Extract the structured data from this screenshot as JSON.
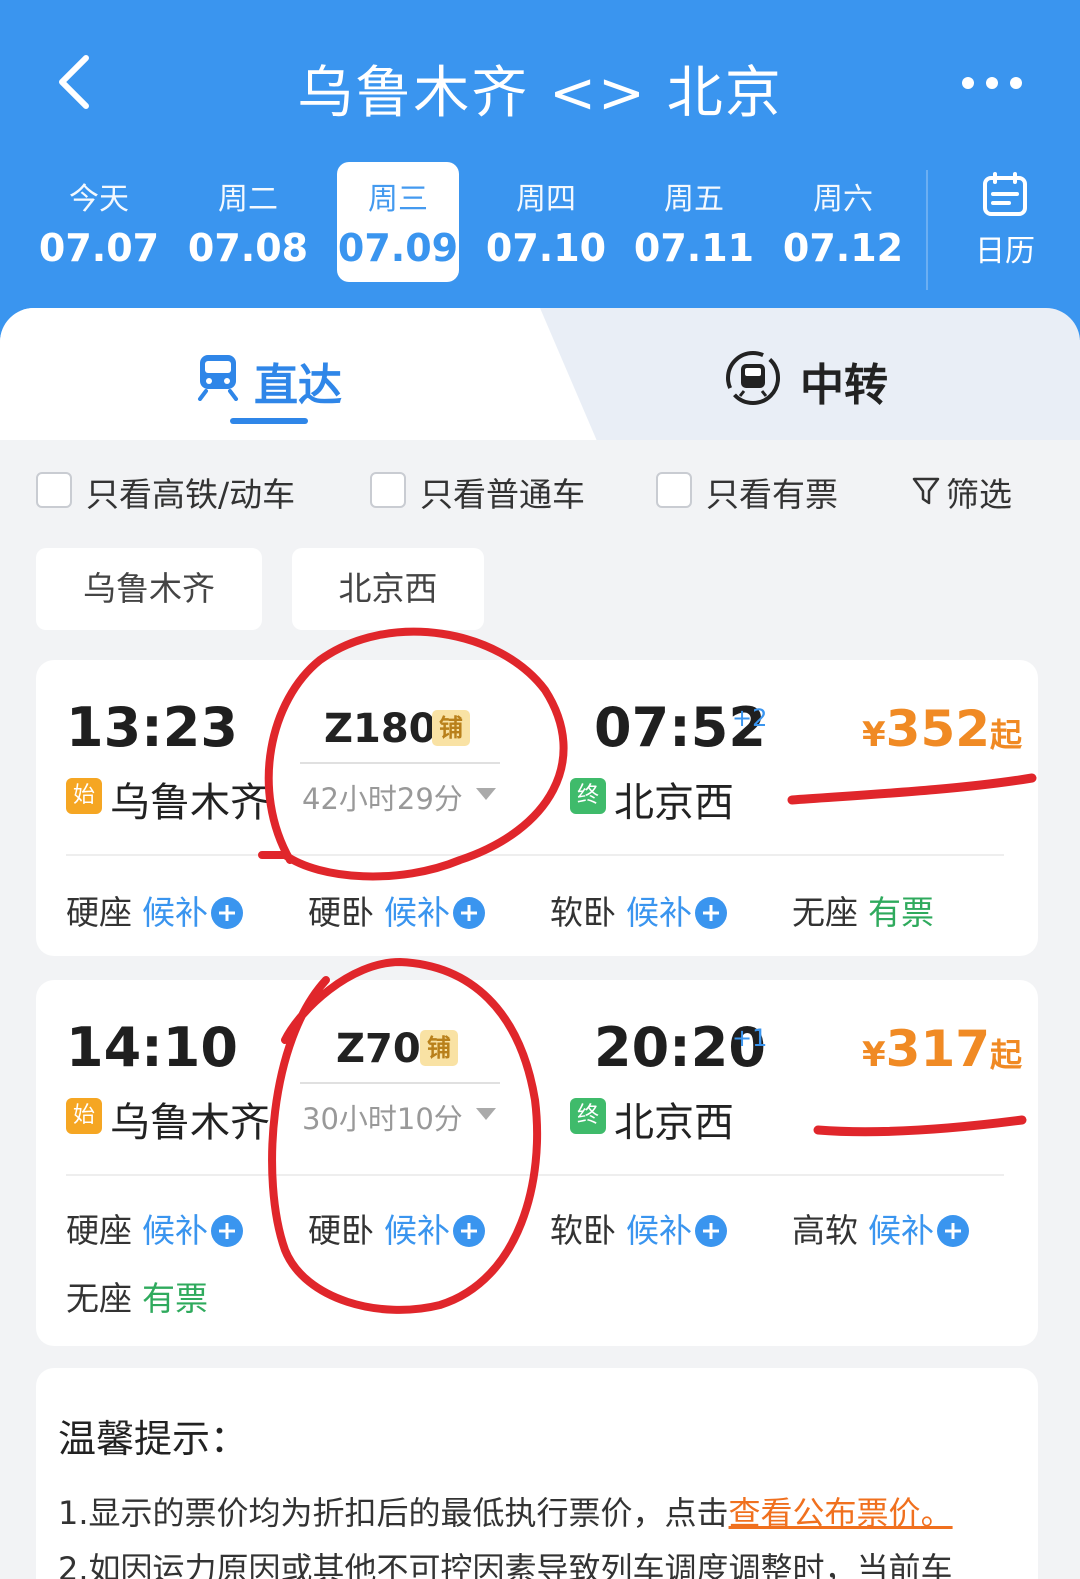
{
  "header": {
    "title": "乌鲁木齐 <> 北京",
    "back_icon": "chevron-left-icon",
    "more_icon": "more-dots-icon",
    "background": "#3a95ef"
  },
  "dates": [
    {
      "weekday": "今天",
      "date": "07.07",
      "selected": false
    },
    {
      "weekday": "周二",
      "date": "07.08",
      "selected": false
    },
    {
      "weekday": "周三",
      "date": "07.09",
      "selected": true
    },
    {
      "weekday": "周四",
      "date": "07.10",
      "selected": false
    },
    {
      "weekday": "周五",
      "date": "07.11",
      "selected": false
    },
    {
      "weekday": "周六",
      "date": "07.12",
      "selected": false
    }
  ],
  "calendar": {
    "label": "日历",
    "icon": "calendar-icon"
  },
  "tabs": {
    "direct": {
      "label": "直达",
      "icon": "train-icon",
      "active": true
    },
    "transfer": {
      "label": "中转",
      "icon": "transfer-train-icon",
      "active": false
    }
  },
  "filters": {
    "high_speed": {
      "label": "只看高铁/动车",
      "checked": false
    },
    "normal": {
      "label": "只看普通车",
      "checked": false
    },
    "available": {
      "label": "只看有票",
      "checked": false
    },
    "filter_button": {
      "label": "筛选",
      "icon": "funnel-icon"
    }
  },
  "stations": {
    "from": "乌鲁木齐",
    "to": "北京西"
  },
  "trains": [
    {
      "dep_time": "13:23",
      "arr_time": "07:52",
      "day_offset": "+2",
      "train_no": "Z180",
      "berth_badge": "铺",
      "duration": "42小时29分",
      "from_badge": "始",
      "from_station": "乌鲁木齐",
      "to_badge": "终",
      "to_station": "北京西",
      "price_yen": "¥",
      "price": "352",
      "price_suffix": "起",
      "seats": [
        {
          "type": "硬座",
          "status": "候补"
        },
        {
          "type": "硬卧",
          "status": "候补"
        },
        {
          "type": "软卧",
          "status": "候补"
        },
        {
          "type": "无座",
          "status": "有票"
        }
      ]
    },
    {
      "dep_time": "14:10",
      "arr_time": "20:20",
      "day_offset": "+1",
      "train_no": "Z70",
      "berth_badge": "铺",
      "duration": "30小时10分",
      "from_badge": "始",
      "from_station": "乌鲁木齐",
      "to_badge": "终",
      "to_station": "北京西",
      "price_yen": "¥",
      "price": "317",
      "price_suffix": "起",
      "seats": [
        {
          "type": "硬座",
          "status": "候补"
        },
        {
          "type": "硬卧",
          "status": "候补"
        },
        {
          "type": "软卧",
          "status": "候补"
        },
        {
          "type": "高软",
          "status": "候补"
        },
        {
          "type": "无座",
          "status": "有票"
        }
      ]
    }
  ],
  "tips": {
    "title": "温馨提示：",
    "line1_text": "1.显示的票价均为折扣后的最低执行票价，点击",
    "line1_link": "查看公布票价",
    "line1_end": "。",
    "line2_text": "2.如因运力原因或其他不可控因素导致列车调度调整时，当前车"
  },
  "colors": {
    "accent": "#3a95ef",
    "price": "#f08a24",
    "available": "#2faa5d",
    "annotation": "#e0262b"
  }
}
